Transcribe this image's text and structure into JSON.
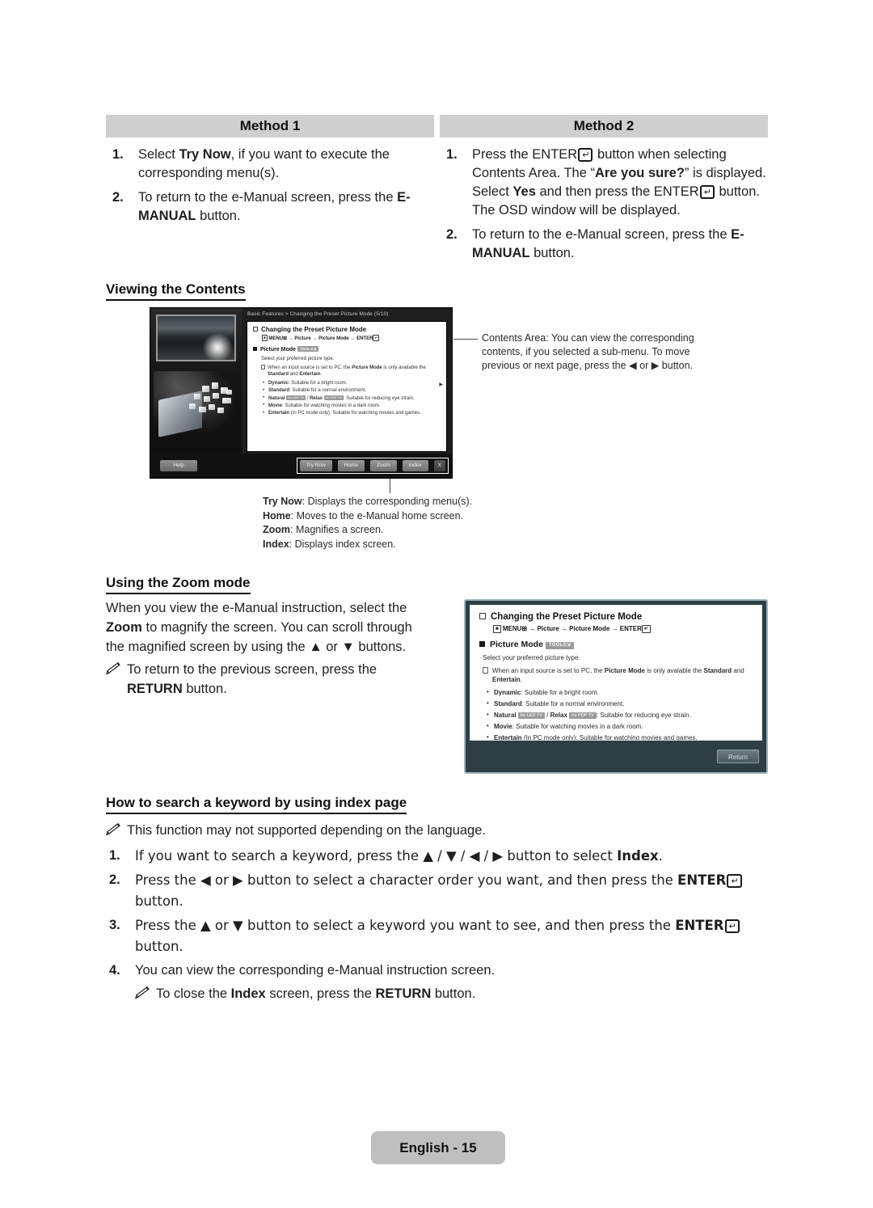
{
  "methods": {
    "method1": {
      "header": "Method 1",
      "steps": [
        {
          "num": "1.",
          "html": "Select <b>Try Now</b>, if you want to execute the corresponding menu(s)."
        },
        {
          "num": "2.",
          "html": "To return to the e-Manual screen, press the <b>E-MANUAL</b> button."
        }
      ]
    },
    "method2": {
      "header": "Method 2",
      "steps": [
        {
          "num": "1.",
          "html": "Press the ENTER<span class=\"enter-key\">&#8629;</span> button when selecting Contents Area. The “<b>Are you sure?</b>” is displayed. Select <b>Yes</b> and then press the ENTER<span class=\"enter-key\">&#8629;</span> button. The OSD window will be displayed."
        },
        {
          "num": "2.",
          "html": "To return to the e-Manual screen, press the <b>E-MANUAL</b> button."
        }
      ]
    }
  },
  "sections": {
    "viewing_contents": "Viewing the Contents",
    "zoom_mode": "Using the Zoom mode",
    "keyword_search": "How to search a keyword by using index page"
  },
  "tv_screenshot": {
    "breadcrumb": "Basic Features > Changing the Preset Picture Mode (5/10)",
    "content_title": "Changing the Preset Picture Mode",
    "menu_path": "MENU&#8862; → Picture → Picture Mode → ENTER",
    "sub_title": "Picture Mode",
    "tools_tag": "TOOLS⇲",
    "description": "Select your preferred picture type.",
    "note": "When an input source is set to PC, the <b>Picture Mode</b> is only available the <b>Standard</b> and <b>Entertain</b>.",
    "options": [
      "<b>Dynamic</b>: Suitable for a bright room.",
      "<b>Standard</b>: Suitable for a normal environment.",
      "<b>Natural</b> <span class=\"tag-sm\">for LED TV</span> / <b>Relax</b> <span class=\"tag-sm\">for PDP TV</span>: Suitable for reducing eye strain.",
      "<b>Movie</b>: Suitable for watching movies in a dark room.",
      "<b>Entertain</b> (In PC mode only): Suitable for watching movies and games."
    ],
    "help_button": "Help",
    "buttons": [
      "Try Now",
      "Home",
      "Zoom",
      "Index"
    ],
    "close_button": "X"
  },
  "callout": {
    "contents_area": "Contents Area: You can view the corresponding contents, if you selected a sub-menu. To move previous or next page, press the ◀ or ▶ button."
  },
  "button_legend": [
    {
      "name": "Try Now",
      "desc": ": Displays the corresponding menu(s)."
    },
    {
      "name": "Home",
      "desc": ": Moves to the e-Manual home screen."
    },
    {
      "name": "Zoom",
      "desc": ": Magnifies a screen."
    },
    {
      "name": "Index",
      "desc": ": Displays index screen."
    }
  ],
  "zoom_mode": {
    "paragraph": "When you view the e-Manual instruction, select the <b>Zoom</b> to magnify the screen. You can scroll through the magnified screen by using the ▲ or ▼ buttons.",
    "note": "To return to the previous screen, press the <b>RETURN</b> button."
  },
  "zoom_panel": {
    "title": "Changing the Preset Picture Mode",
    "menu_path": "MENU&#8862; → Picture → Picture Mode → ENTER",
    "sub_title": "Picture Mode",
    "tools_tag": "TOOLS⇲",
    "description": "Select your preferred picture type.",
    "note": "When an input source is set to PC, the <b>Picture Mode</b> is only avalable the <b>Standard</b> and <b>Entertain</b>.",
    "options": [
      "<b>Dynamic</b>: Suitable for a bright room.",
      "<b>Standard</b>: Suitable for a normal environment.",
      "<b>Natural</b> <span class=\"tag-sm2\">for LED TV</span> / <b>Relax</b> <span class=\"tag-sm2\">for PDP TV</span>: Suitable for reducing eye strain.",
      "<b>Movie</b>: Suitable for watching movies in a dark room.",
      "<b>Entertain</b> (In PC mode only): Suitable for watching movies and games."
    ],
    "scroll_down": "▼",
    "return_button": "Return"
  },
  "keyword_section": {
    "note": "This function may not supported depending on the language.",
    "steps": [
      {
        "num": "1.",
        "html": "If you want to search a keyword, press the ▲ / ▼ / ◀ / ▶ button to select <b>Index</b>."
      },
      {
        "num": "2.",
        "html": "Press the ◀ or ▶ button to select a character order you want, and then press the <b>ENTER</b><span class=\"enter-key\">&#8629;</span> button."
      },
      {
        "num": "3.",
        "html": "Press the ▲ or ▼ button to select a keyword you want to see, and then press the <b>ENTER</b><span class=\"enter-key\">&#8629;</span> button."
      },
      {
        "num": "4.",
        "html": "You can view the corresponding e-Manual instruction screen."
      }
    ],
    "sub_note": "To close the <b>Index</b> screen, press the <b>RETURN</b> button."
  },
  "footer": {
    "page_label": "English - 15"
  },
  "colors": {
    "header_bar": "#cfcfcf",
    "page_tab": "#bfbfbf",
    "panel_frame": "#2e3e45",
    "panel_border": "#9fb2ba"
  }
}
